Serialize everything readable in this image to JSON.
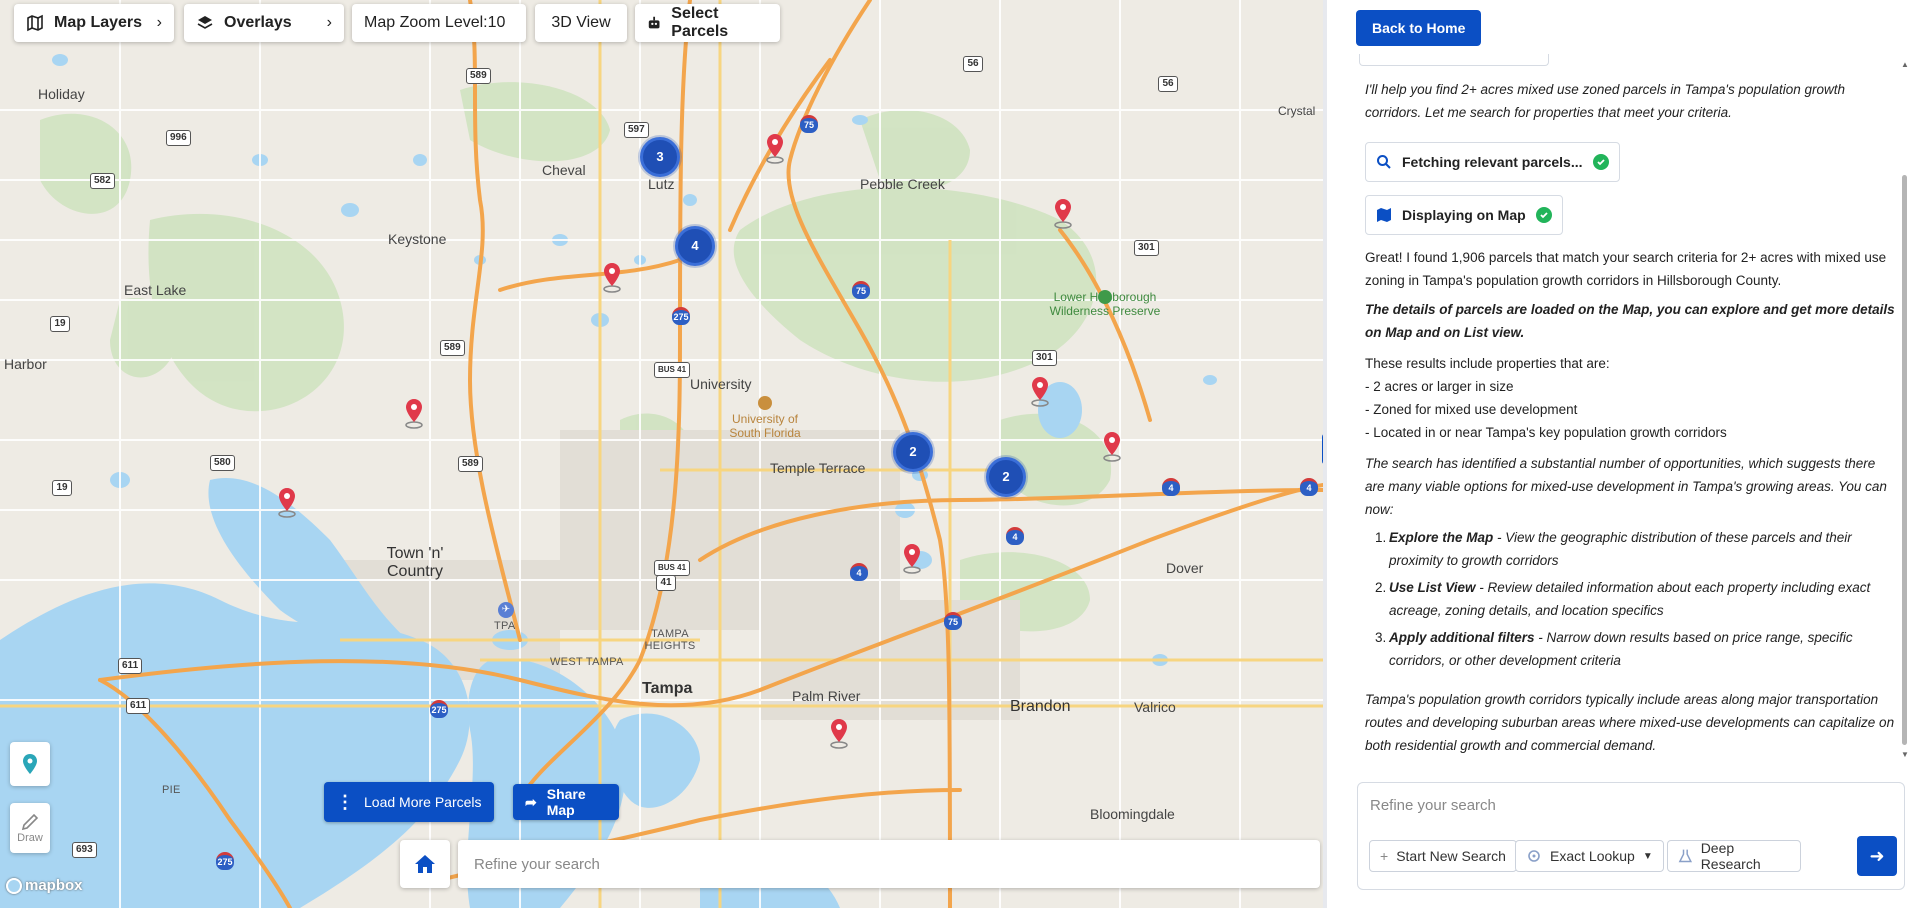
{
  "toolbar": {
    "map_layers": "Map Layers",
    "overlays": "Overlays",
    "zoom_label": "Map Zoom Level:10",
    "view_3d": "3D View",
    "select_parcels": "Select Parcels"
  },
  "map": {
    "places": [
      "Holiday",
      "Cheval",
      "Lutz",
      "Pebble Creek",
      "Keystone",
      "East Lake",
      "Harbor",
      "University",
      "University of South Florida",
      "Temple Terrace",
      "Town 'n' Country",
      "Dover",
      "Tampa",
      "Palm River",
      "Brandon",
      "Valrico",
      "Bloomingdale",
      "Crystal",
      "Lower Hillsborough Wilderness Preserve",
      "TPA",
      "WEST TAMPA",
      "TAMPA HEIGHTS",
      "PIE"
    ],
    "route_shields": [
      "589",
      "597",
      "56",
      "56",
      "996",
      "582",
      "19",
      "275",
      "75",
      "75",
      "301",
      "301",
      "589",
      "589",
      "BUS 41",
      "580",
      "19",
      "41",
      "BUS 41",
      "4",
      "4",
      "4",
      "4",
      "75",
      "611",
      "611",
      "275",
      "693",
      "275"
    ],
    "clusters": [
      "3",
      "4",
      "2",
      "2"
    ],
    "attribution": "mapbox",
    "accent_color": "#1f4fb5",
    "water_color": "#a8d5f2",
    "pin_color": "#e0394a"
  },
  "controls": {
    "draw_label": "Draw",
    "load_more": "Load More Parcels",
    "share_map": "Share Map",
    "search_placeholder": "Refine your search"
  },
  "panel": {
    "back_home": "Back to Home",
    "intro": "I'll help you find 2+ acres mixed use zoned parcels in Tampa's population growth corridors. Let me search for properties that meet your criteria.",
    "status_fetch": "Fetching relevant parcels...",
    "status_display": "Displaying on Map",
    "found": "Great! I found 1,906 parcels that match your search criteria for 2+ acres with mixed use zoning in Tampa's population growth corridors in Hillsborough County.",
    "details_bold": "The details of parcels are loaded on the Map, you can explore and get more details on Map and on List view.",
    "results_intro": "These results include properties that are:",
    "results": [
      "- 2 acres or larger in size",
      "- Zoned for mixed use development",
      "- Located in or near Tampa's key population growth corridors"
    ],
    "opportunities": "The search has identified a substantial number of opportunities, which suggests there are many viable options for mixed-use development in Tampa's growing areas. You can now:",
    "steps": [
      {
        "num": "1.",
        "title": "Explore the Map",
        "text": " - View the geographic distribution of these parcels and their proximity to growth corridors"
      },
      {
        "num": "2.",
        "title": "Use List View",
        "text": " - Review detailed information about each property including exact acreage, zoning details, and location specifics"
      },
      {
        "num": "3.",
        "title": "Apply additional filters",
        "text": " - Narrow down results based on price range, specific corridors, or other development criteria"
      }
    ],
    "closing": "Tampa's population growth corridors typically include areas along major transportation routes and developing suburban areas where mixed-use developments can capitalize on both residential growth and commercial demand.",
    "refine_placeholder": "Refine your search",
    "start_new": "Start New Search",
    "exact_lookup": "Exact Lookup",
    "deep_research": "Deep Research"
  }
}
